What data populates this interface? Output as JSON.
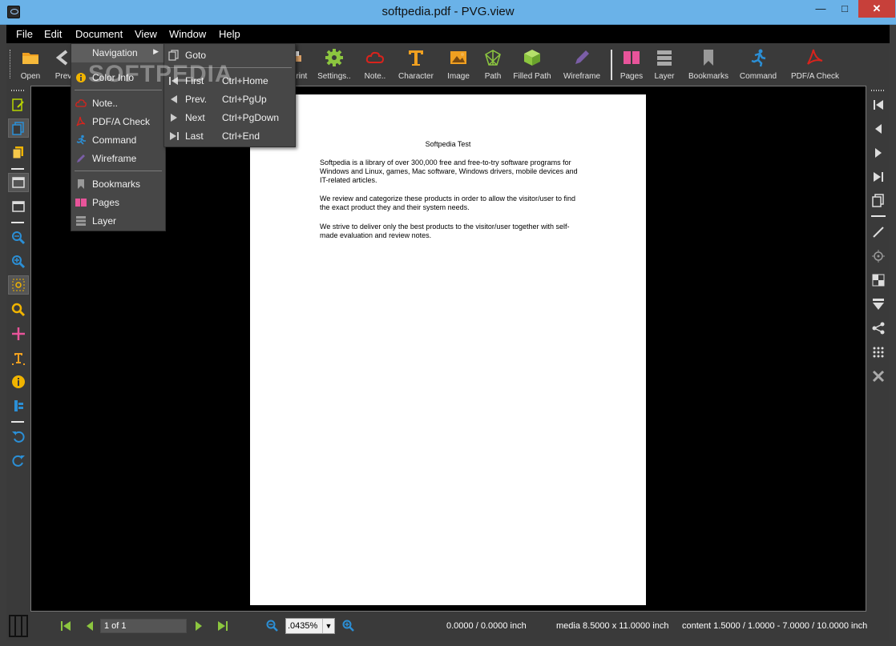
{
  "window": {
    "title": "softpedia.pdf - PVG.view"
  },
  "menubar": [
    "File",
    "Edit",
    "Document",
    "View",
    "Window",
    "Help"
  ],
  "toolbar": {
    "open": "Open",
    "prev": "Prev",
    "print": "Print",
    "settings": "Settings..",
    "note": "Note..",
    "character": "Character",
    "image": "Image",
    "path": "Path",
    "filled_path": "Filled Path",
    "wireframe": "Wireframe",
    "pages": "Pages",
    "layer": "Layer",
    "bookmarks": "Bookmarks",
    "command": "Command",
    "pdfa_check": "PDF/A Check"
  },
  "window_menu": {
    "navigation": "Navigation",
    "color_info": "Color Info",
    "note": "Note..",
    "pdfa_check": "PDF/A Check",
    "command": "Command",
    "wireframe": "Wireframe",
    "bookmarks": "Bookmarks",
    "pages": "Pages",
    "layer": "Layer"
  },
  "navigation_menu": {
    "goto": "Goto",
    "first": "First",
    "first_sc": "Ctrl+Home",
    "prev": "Prev.",
    "prev_sc": "Ctrl+PgUp",
    "next": "Next",
    "next_sc": "Ctrl+PgDown",
    "last": "Last",
    "last_sc": "Ctrl+End"
  },
  "watermark": "SOFTPEDIA",
  "document": {
    "title": "Softpedia Test",
    "paragraphs": [
      "Softpedia is a library of over 300,000 free and free-to-try software programs for Windows and Linux, games, Mac software, Windows drivers, mobile devices and IT-related articles.",
      "We review and categorize these products in order to allow the visitor/user to find the exact product they and their system needs.",
      "We strive to deliver only the best products to the visitor/user together with self-made evaluation and review notes."
    ]
  },
  "status": {
    "page": "1 of 1",
    "zoom": ".0435%",
    "cursor": "0.0000 / 0.0000 inch",
    "media": "media 8.5000 x 11.0000 inch",
    "content": "content 1.5000 / 1.0000 - 7.0000 / 10.0000 inch"
  },
  "colors": {
    "accent_yellow": "#f0b400",
    "accent_green": "#8cc63f",
    "accent_blue": "#2b8fd6",
    "accent_red": "#d9231c",
    "accent_pink": "#e8549a",
    "accent_purple": "#7b5ea7"
  }
}
